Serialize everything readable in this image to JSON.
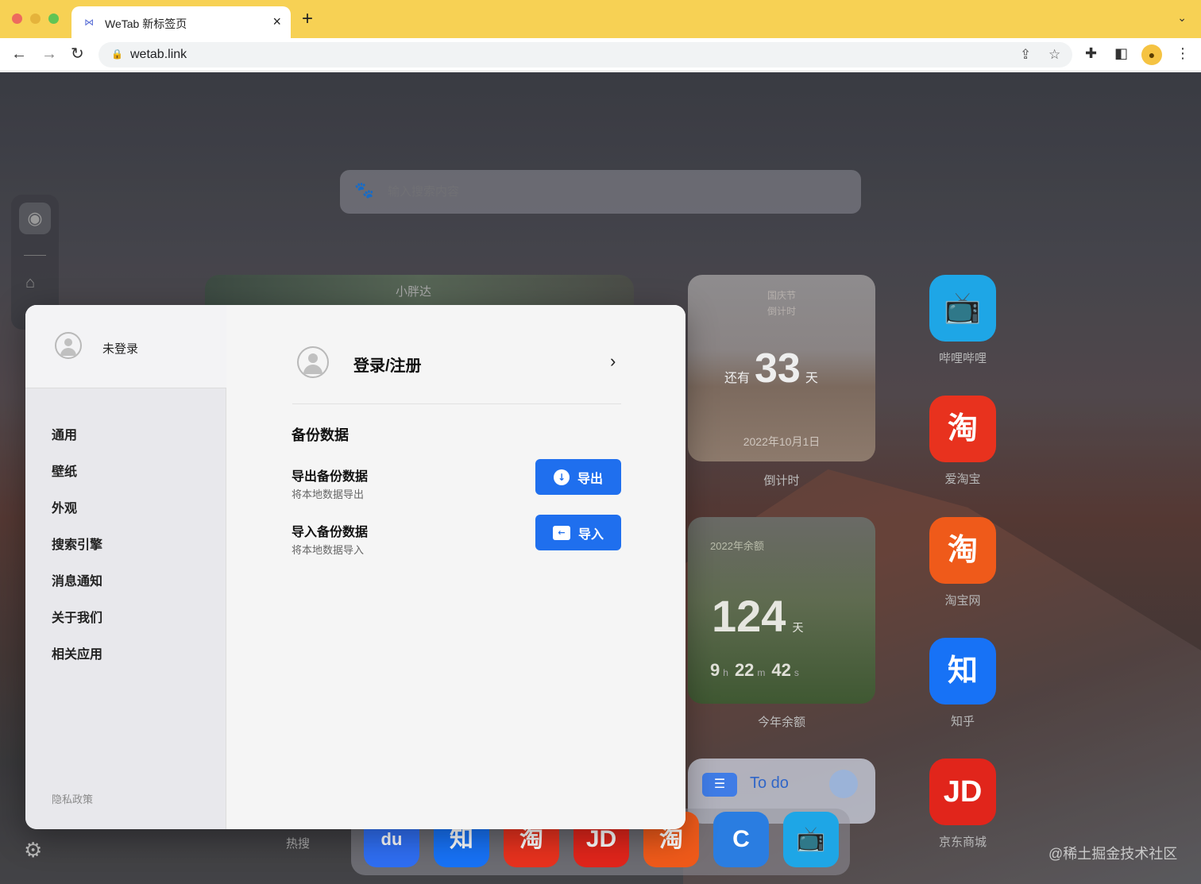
{
  "browser": {
    "tab_title": "WeTab 新标签页",
    "url": "wetab.link"
  },
  "search": {
    "placeholder": "输入搜索内容"
  },
  "widgets": {
    "news": {
      "title": "小胖达"
    },
    "countdown": {
      "event": "国庆节",
      "subtitle": "倒计时",
      "prefix": "还有",
      "days": "33",
      "unit": "天",
      "date": "2022年10月1日",
      "label": "倒计时"
    },
    "year_left": {
      "title": "2022年余额",
      "days": "124",
      "days_unit": "天",
      "hours": "9",
      "hours_unit": "h",
      "minutes": "22",
      "minutes_unit": "m",
      "seconds": "42",
      "seconds_unit": "s",
      "label": "今年余额"
    },
    "todo": {
      "title": "To do"
    }
  },
  "apps": [
    {
      "name": "哔哩哔哩",
      "icon": "bilibili-icon",
      "glyph": "📺",
      "color": "#1ea6e6"
    },
    {
      "name": "爱淘宝",
      "icon": "taobao-icon",
      "glyph": "淘",
      "color": "#e8321e"
    },
    {
      "name": "淘宝网",
      "icon": "taobao-icon",
      "glyph": "淘",
      "color": "#ef5a1a"
    },
    {
      "name": "知乎",
      "icon": "zhihu-icon",
      "glyph": "知",
      "color": "#1772f6"
    },
    {
      "name": "京东商城",
      "icon": "jd-icon",
      "glyph": "JD",
      "color": "#e1251b"
    }
  ],
  "dock": {
    "hot_label": "热搜",
    "apps": [
      {
        "icon": "baidu-icon",
        "glyph": "du",
        "color": "#2f6ef2"
      },
      {
        "icon": "zhihu-icon",
        "glyph": "知",
        "color": "#1772f6"
      },
      {
        "icon": "taobao-icon",
        "glyph": "淘",
        "color": "#e8321e"
      },
      {
        "icon": "jd-icon",
        "glyph": "JD",
        "color": "#e1251b"
      },
      {
        "icon": "taobao-icon",
        "glyph": "淘",
        "color": "#ef5a1a"
      },
      {
        "icon": "dolphin-icon",
        "glyph": "C",
        "color": "#2a7de1"
      },
      {
        "icon": "bilibili-icon",
        "glyph": "📺",
        "color": "#1ea6e6"
      }
    ]
  },
  "watermark": "@稀土掘金技术社区",
  "settings_modal": {
    "user_status": "未登录",
    "nav": [
      "通用",
      "壁纸",
      "外观",
      "搜索引擎",
      "消息通知",
      "关于我们",
      "相关应用"
    ],
    "privacy": "隐私政策",
    "login_label": "登录/注册",
    "section_title": "备份数据",
    "export": {
      "title": "导出备份数据",
      "subtitle": "将本地数据导出",
      "button": "导出"
    },
    "import": {
      "title": "导入备份数据",
      "subtitle": "将本地数据导入",
      "button": "导入"
    }
  }
}
